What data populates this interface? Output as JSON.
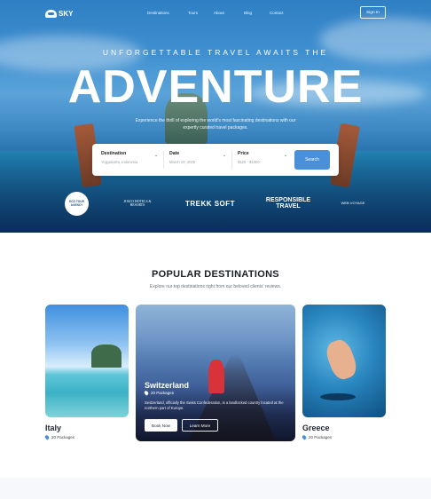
{
  "brand": {
    "name": "SKY"
  },
  "nav": {
    "links": [
      "Destinations",
      "Tours",
      "About",
      "Blog",
      "Contact"
    ],
    "signin_label": "Sign In"
  },
  "hero": {
    "tagline": "UNFORGETTABLE TRAVEL AWAITS THE",
    "headline": "ADVENTURE",
    "subcopy": "Experience the thrill of exploring the world's most fascinating destinations with our expertly curated travel packages."
  },
  "search": {
    "destination": {
      "label": "Destination",
      "placeholder": "Yogyakarta, Indonesia"
    },
    "date": {
      "label": "Date",
      "value": "March 19, 2025"
    },
    "price": {
      "label": "Price",
      "value": "$120 - $1000"
    },
    "button_label": "Search"
  },
  "partners": [
    "ECO TOUR AGENCY",
    "JOSCO HOTELS & RESORTS",
    "TREKK SOFT",
    "RESPONSIBLE TRAVEL",
    "WEB VOYAGE"
  ],
  "destinations_section": {
    "title": "POPULAR DESTINATIONS",
    "subtitle": "Explore our top destinations right from our beloved clients' reviews."
  },
  "cards": [
    {
      "name": "Italy",
      "packages": "20 Packages"
    },
    {
      "name": "Switzerland",
      "packages": "20 Packages",
      "description": "Switzerland, officially the Swiss Confederation, is a landlocked country located at the northern part of Europe.",
      "book_label": "Book Now",
      "learn_label": "Learn More"
    },
    {
      "name": "Greece",
      "packages": "20 Packages"
    }
  ],
  "colors": {
    "accent": "#4a90d9",
    "hero_blue": "#2f7fc4"
  }
}
